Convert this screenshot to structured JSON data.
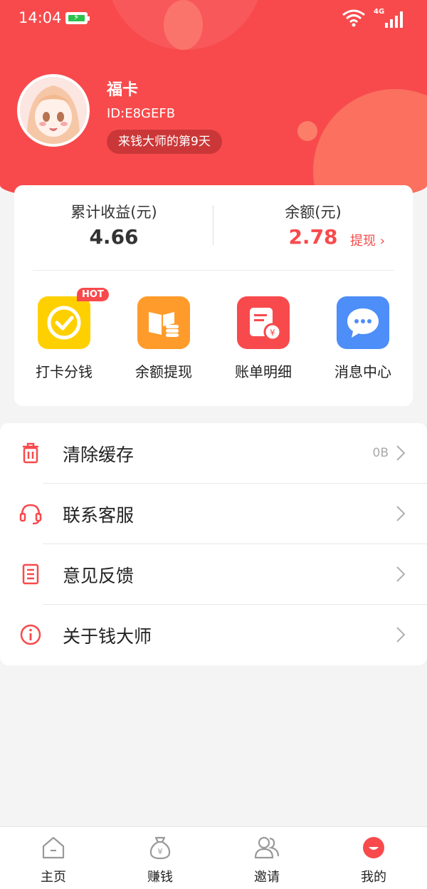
{
  "status_bar": {
    "time": "14:04",
    "network": "4G"
  },
  "profile": {
    "name": "福卡",
    "id": "ID:E8GEFB",
    "days_badge": "来钱大师的第9天"
  },
  "earnings": {
    "total_label": "累计收益(元)",
    "total_value": "4.66",
    "balance_label": "余额(元)",
    "balance_value": "2.78",
    "withdraw_label": "提现 ›"
  },
  "quick_actions": [
    {
      "label": "打卡分钱",
      "icon": "checkin-icon",
      "badge": "HOT",
      "color": "#ffd000"
    },
    {
      "label": "余额提现",
      "icon": "book-coins-icon",
      "color": "#ff9b2b"
    },
    {
      "label": "账单明细",
      "icon": "bill-icon",
      "color": "#f84a4c"
    },
    {
      "label": "消息中心",
      "icon": "chat-icon",
      "color": "#4d8ef8"
    }
  ],
  "menu": [
    {
      "label": "清除缓存",
      "extra": "0B",
      "icon": "trash-icon"
    },
    {
      "label": "联系客服",
      "icon": "headset-icon"
    },
    {
      "label": "意见反馈",
      "icon": "document-icon"
    },
    {
      "label": "关于钱大师",
      "icon": "info-icon"
    }
  ],
  "tabbar": [
    {
      "label": "主页",
      "icon": "home-icon"
    },
    {
      "label": "赚钱",
      "icon": "money-bag-icon"
    },
    {
      "label": "邀请",
      "icon": "people-icon"
    },
    {
      "label": "我的",
      "icon": "me-icon",
      "active": true
    }
  ],
  "colors": {
    "accent": "#f84a4c",
    "background": "#f4f4f4"
  }
}
